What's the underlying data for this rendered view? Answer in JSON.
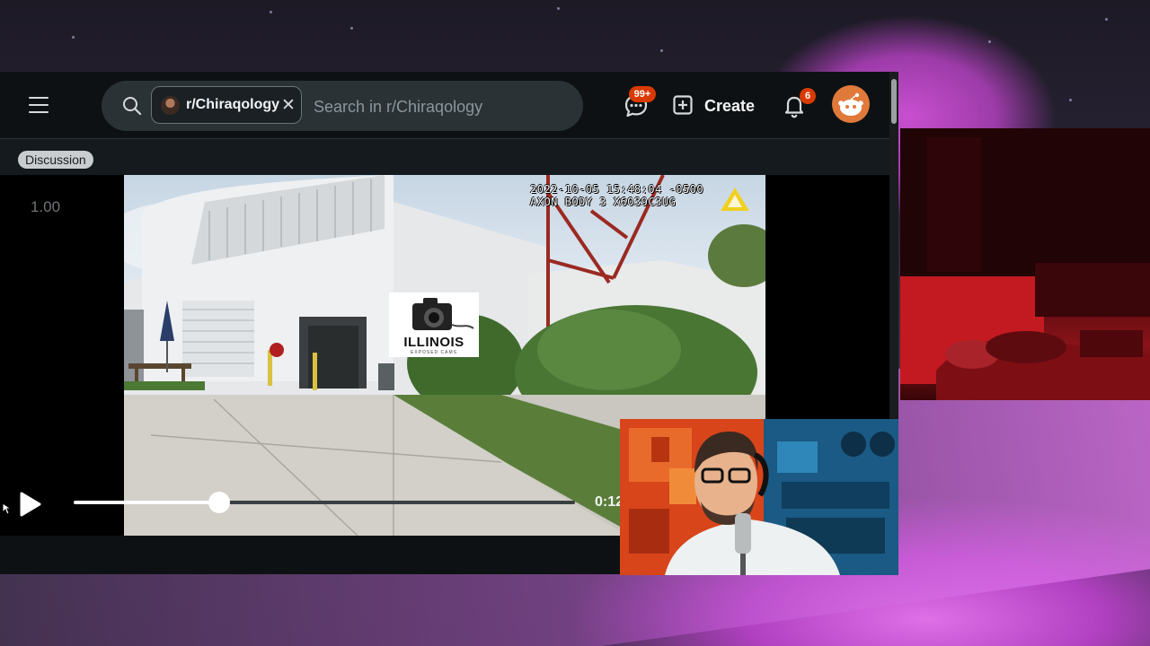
{
  "header": {
    "search": {
      "community_chip": "r/Chiraqology",
      "placeholder": "Search in r/Chiraqology"
    },
    "chat_badge": "99+",
    "create_label": "Create",
    "notification_badge": "6"
  },
  "post": {
    "flair": "Discussion"
  },
  "video": {
    "playback_rate": "1.00",
    "current_time": "0:12",
    "progress": 0.29,
    "overlay_timestamp": "2022-10-05 15:48:04 -0500",
    "overlay_device": "AXON BODY 3 X6039C3UG",
    "watermark": {
      "title": "ILLINOIS",
      "subtitle": "EXPOSED CAMS"
    }
  },
  "colors": {
    "badge": "#d93a00",
    "app_background": "#0e1113",
    "search_background": "#2a3236"
  },
  "icons": [
    "menu-icon",
    "search-icon",
    "close-icon",
    "chat-icon",
    "plus-square-icon",
    "bell-icon",
    "play-icon",
    "cursor-icon"
  ]
}
